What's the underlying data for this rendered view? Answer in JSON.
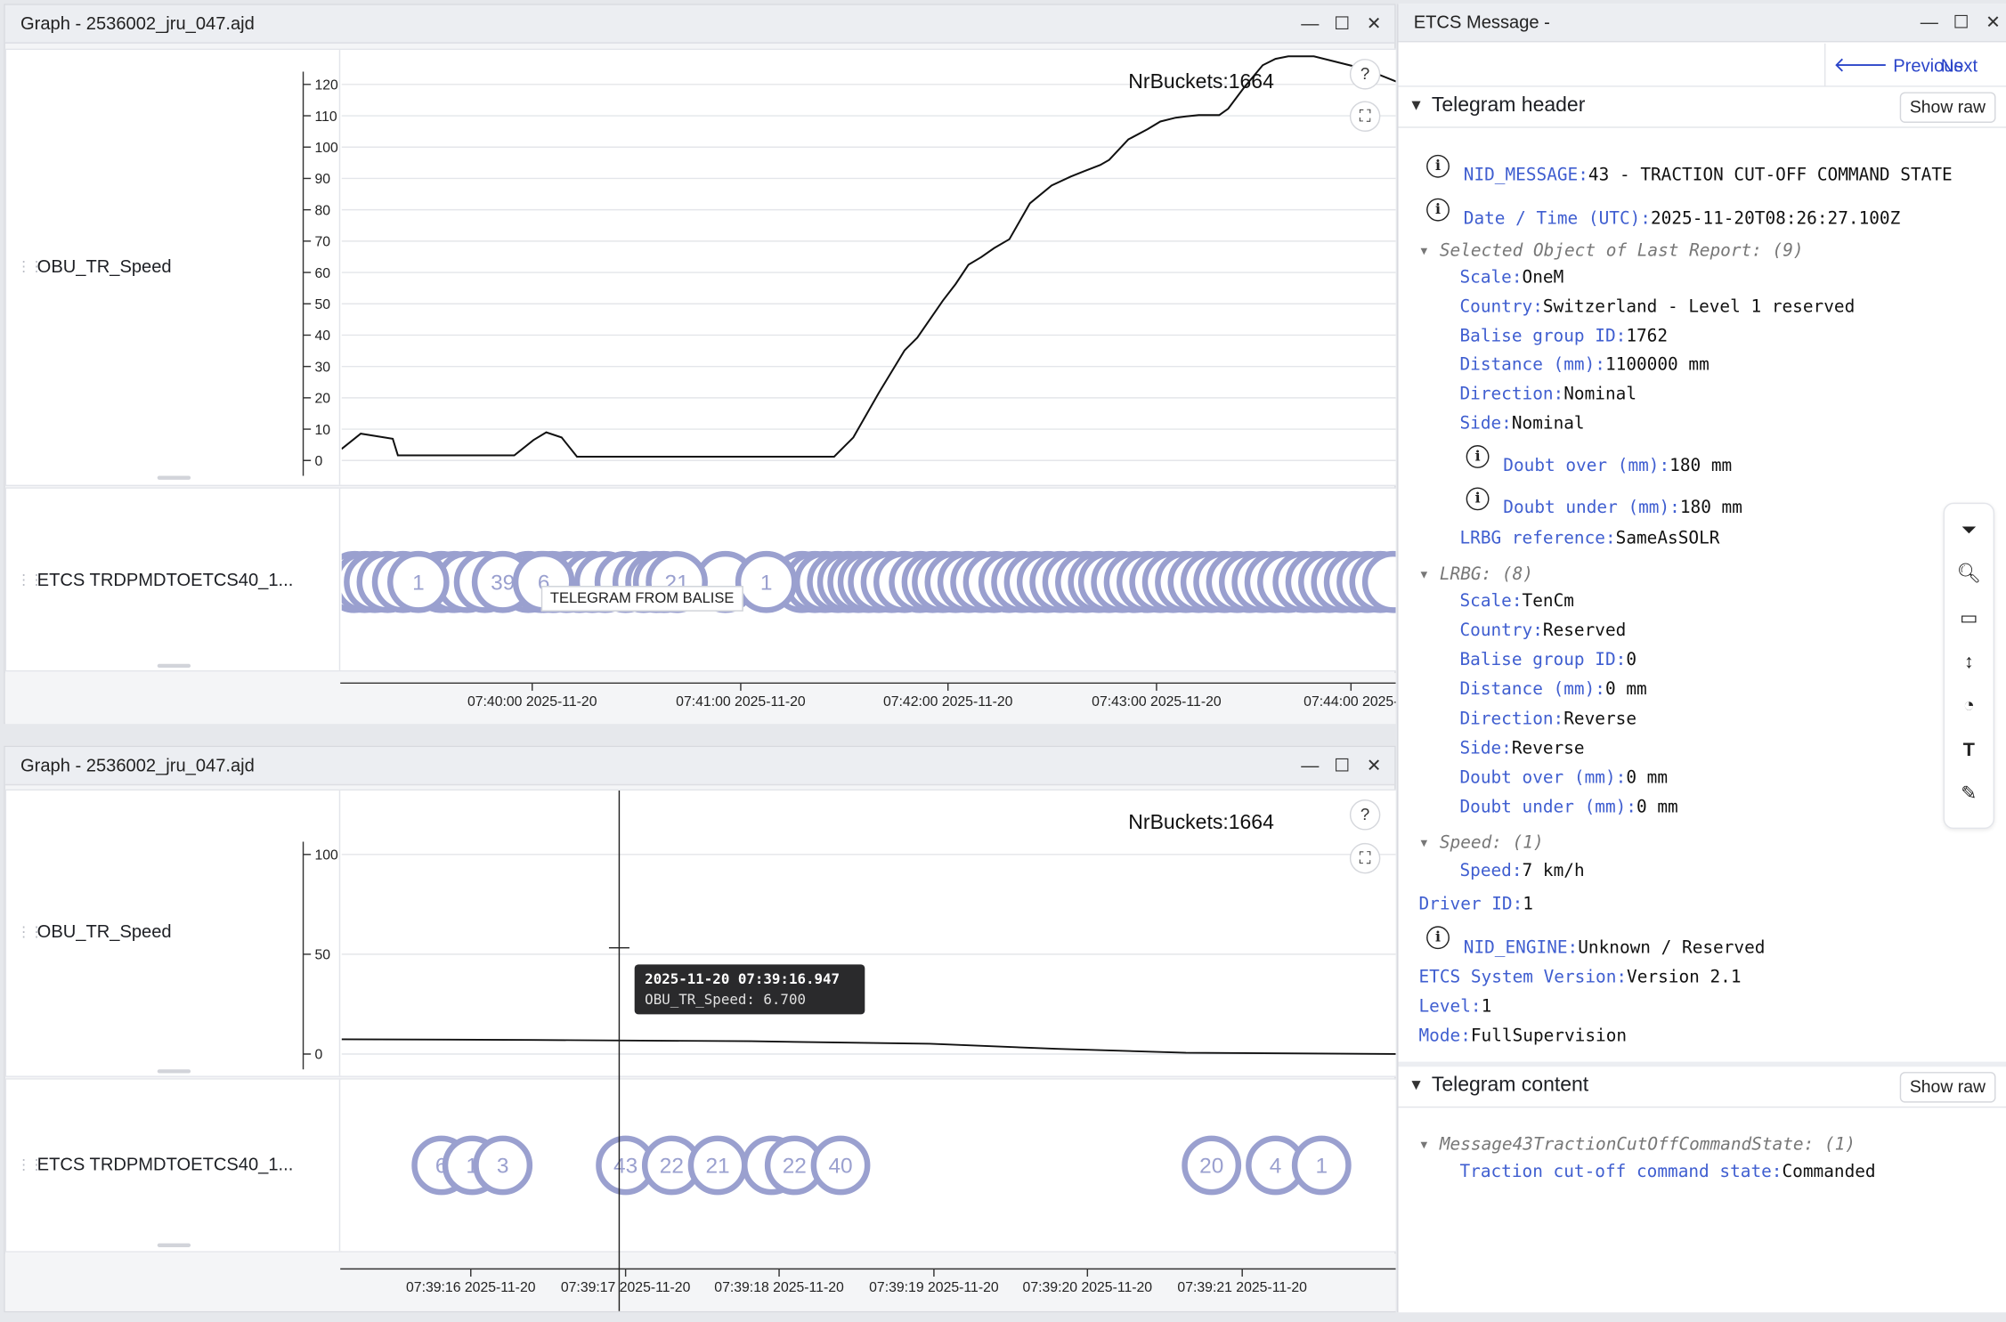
{
  "top_window": {
    "title": "Graph - 2536002_jru_047.ajd",
    "buttons": {
      "minimize": "—",
      "maximize": "☐",
      "close": "✕"
    },
    "speed_channel": "OBU_TR_Speed",
    "etcs_channel": "ETCS TRDPMDTOETCS40_1...",
    "nrbuckets": "NrBuckets:1664",
    "help": "?",
    "fullscreen": "⛶",
    "y_ticks": [
      "120",
      "110",
      "100",
      "90",
      "80",
      "70",
      "60",
      "50",
      "40",
      "30",
      "20",
      "10",
      "0"
    ],
    "y_range": [
      0,
      120
    ],
    "x_ticks": [
      "07:40:00 2025-11-20",
      "07:41:00 2025-11-20",
      "07:42:00 2025-11-20",
      "07:43:00 2025-11-20",
      "07:44:00 2025-"
    ],
    "bubbles": [
      "1",
      "39",
      "6",
      "21",
      "1"
    ],
    "balise_tooltip": "TELEGRAM FROM BALISE"
  },
  "bottom_window": {
    "title": "Graph - 2536002_jru_047.ajd",
    "buttons": {
      "minimize": "—",
      "maximize": "☐",
      "close": "✕"
    },
    "speed_channel": "OBU_TR_Speed",
    "etcs_channel": "ETCS TRDPMDTOETCS40_1...",
    "nrbuckets": "NrBuckets:1664",
    "help": "?",
    "fullscreen": "⛶",
    "y_ticks": [
      "100",
      "50",
      "0"
    ],
    "y_range": [
      0,
      100
    ],
    "x_ticks": [
      "07:39:16 2025-11-20",
      "07:39:17 2025-11-20",
      "07:39:18 2025-11-20",
      "07:39:19 2025-11-20",
      "07:39:20 2025-11-20",
      "07:39:21 2025-11-20"
    ],
    "bubbles": [
      "6",
      "1",
      "3",
      "43",
      "22",
      "21",
      "22",
      "40",
      "20",
      "4",
      "1"
    ],
    "tooltip": {
      "title": "2025-11-20 07:39:16.947",
      "line": "OBU_TR_Speed: 6.700"
    }
  },
  "etcs_message": {
    "title": "ETCS Message -",
    "buttons": {
      "minimize": "—",
      "maximize": "☐",
      "close": "✕"
    },
    "prev": "Previous",
    "next": "Next",
    "telegram_header": "Telegram header",
    "telegram_content": "Telegram content",
    "show_raw": "Show raw",
    "nid_message": {
      "k": "NID_MESSAGE:",
      "v": "43 - TRACTION CUT-OFF COMMAND STATE"
    },
    "datetime": {
      "k": "Date / Time (UTC):",
      "v": "2025-11-20T08:26:27.100Z"
    },
    "sol_group": "Selected Object of Last Report: (9)",
    "sol": [
      {
        "k": "Scale:",
        "v": "OneM"
      },
      {
        "k": "Country:",
        "v": "Switzerland - Level 1 reserved"
      },
      {
        "k": "Balise group ID:",
        "v": "1762"
      },
      {
        "k": "Distance (mm):",
        "v": "1100000 mm"
      },
      {
        "k": "Direction:",
        "v": "Nominal"
      },
      {
        "k": "Side:",
        "v": "Nominal"
      }
    ],
    "doubt_over": {
      "k": "Doubt over (mm):",
      "v": "180 mm"
    },
    "doubt_under": {
      "k": "Doubt under (mm):",
      "v": "180 mm"
    },
    "lrbg_ref": {
      "k": "LRBG reference:",
      "v": "SameAsSOLR"
    },
    "lrbg_group": "LRBG: (8)",
    "lrbg": [
      {
        "k": "Scale:",
        "v": "TenCm"
      },
      {
        "k": "Country:",
        "v": "Reserved"
      },
      {
        "k": "Balise group ID:",
        "v": "0"
      },
      {
        "k": "Distance (mm):",
        "v": "0 mm"
      },
      {
        "k": "Direction:",
        "v": "Reverse"
      },
      {
        "k": "Side:",
        "v": "Reverse"
      },
      {
        "k": "Doubt over (mm):",
        "v": "0 mm"
      },
      {
        "k": "Doubt under (mm):",
        "v": "0 mm"
      }
    ],
    "speed_group": "Speed: (1)",
    "speed": {
      "k": "Speed:",
      "v": "7 km/h"
    },
    "driver": {
      "k": "Driver ID:",
      "v": "1"
    },
    "nid_engine": {
      "k": "NID_ENGINE:",
      "v": "Unknown / Reserved"
    },
    "system_version": {
      "k": "ETCS System Version:",
      "v": "Version 2.1"
    },
    "level": {
      "k": "Level:",
      "v": "1"
    },
    "mode": {
      "k": "Mode:",
      "v": "FullSupervision"
    },
    "content_group": "Message43TractionCutOffCommandState: (1)",
    "content": {
      "k": "Traction cut-off command state:",
      "v": "Commanded"
    }
  },
  "tools": [
    "filter-icon",
    "zoom-icon",
    "ruler-icon",
    "vertical-arrows-icon",
    "gauge-icon",
    "text-icon",
    "pencil-icon"
  ],
  "colors": {
    "bubble": "#9aa0cf",
    "accent": "#3f5ed0"
  }
}
